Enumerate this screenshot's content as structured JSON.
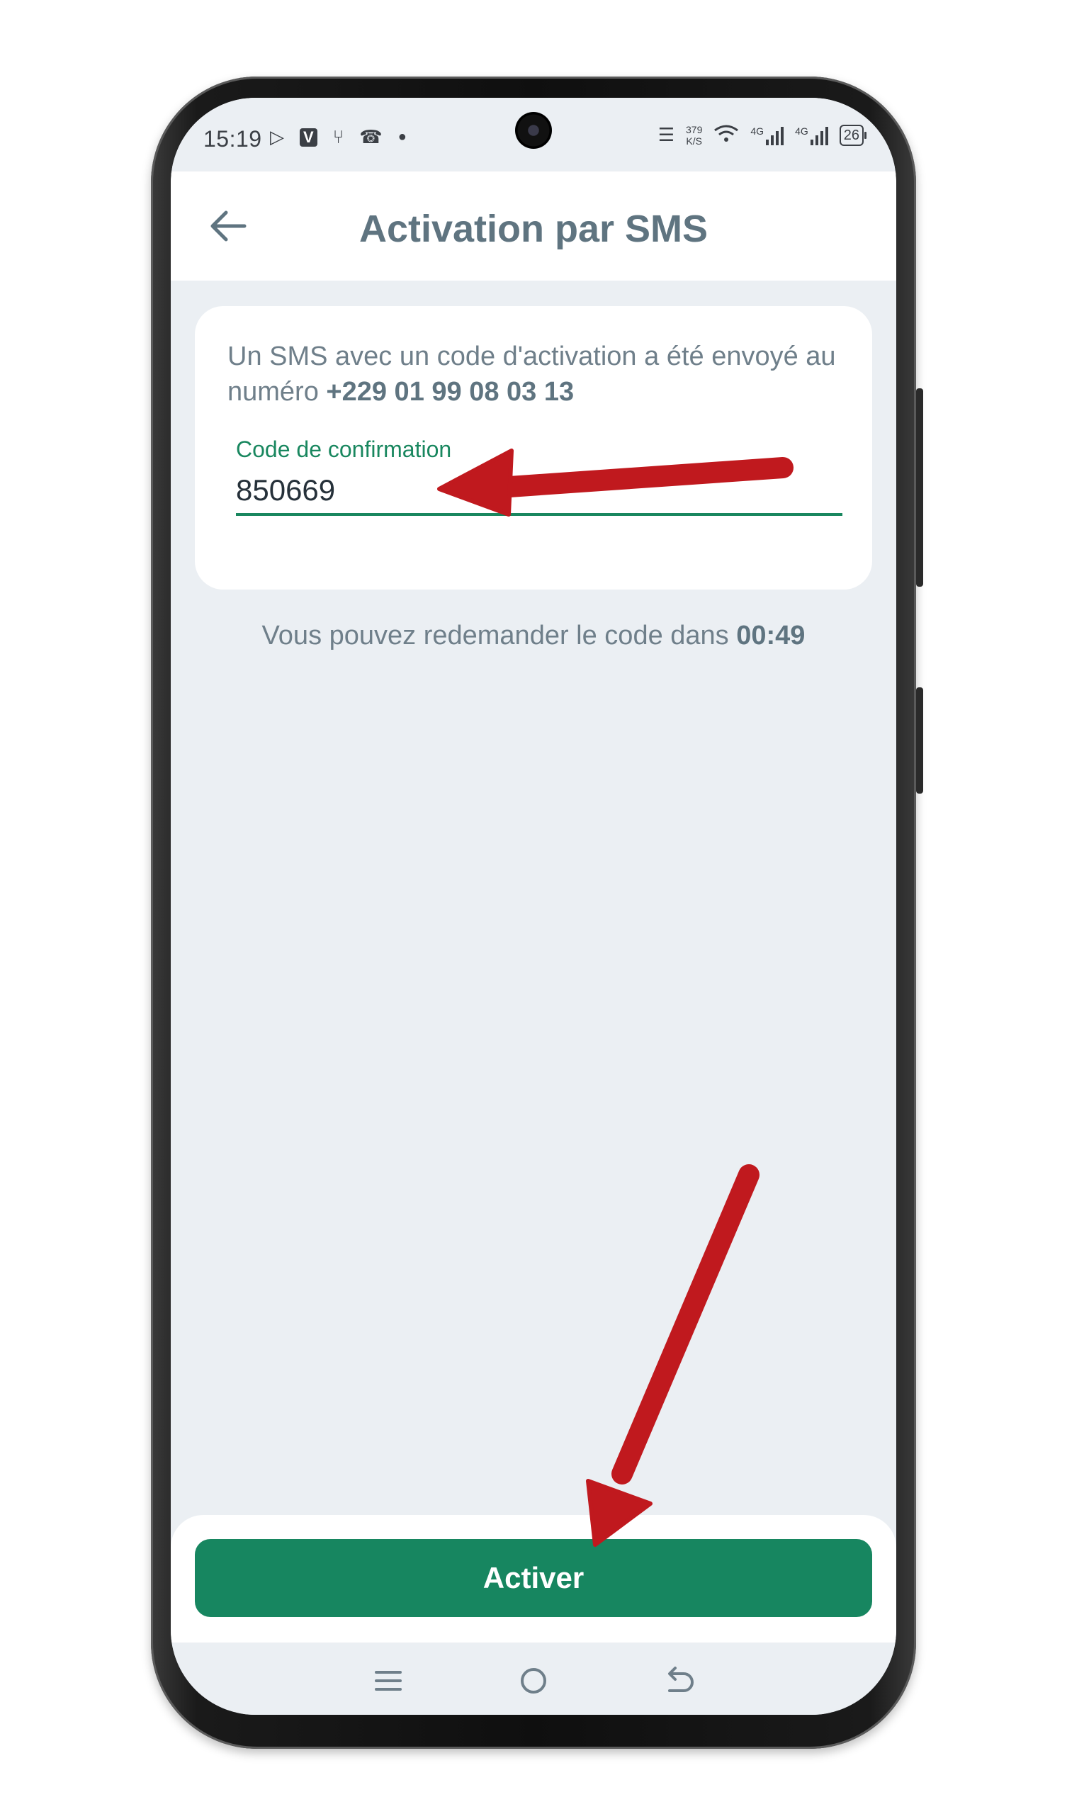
{
  "status_bar": {
    "time": "15:19",
    "network_speed_value": "379",
    "network_speed_unit": "K/S",
    "signal_1_label": "4G",
    "signal_2_label": "4G",
    "battery": "26"
  },
  "header": {
    "title": "Activation par SMS"
  },
  "card": {
    "message_prefix": "Un SMS avec un code d'activation a été envoyé au numéro ",
    "phone_number": "+229 01 99 08 03 13",
    "field_label": "Code de confirmation",
    "field_value": "850669"
  },
  "resend": {
    "text_prefix": "Vous pouvez redemander le code dans ",
    "countdown": "00:49"
  },
  "actions": {
    "activate_label": "Activer"
  },
  "colors": {
    "accent": "#178660",
    "annotation_arrow": "#c0191e",
    "title_color": "#5f7480"
  }
}
